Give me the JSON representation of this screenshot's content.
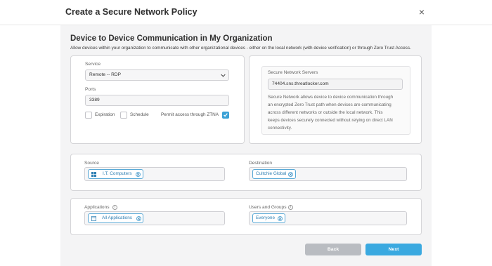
{
  "modal": {
    "title": "Create a Secure Network Policy",
    "close_glyph": "×"
  },
  "section": {
    "title": "Device to Device Communication in My Organization",
    "description": "Allow devices within your organization to communicate with other organizational devices - either on the local network (with device verification) or through Zero Trust Access."
  },
  "service": {
    "label": "Service",
    "value": "Remote -- RDP"
  },
  "ports": {
    "label": "Ports",
    "value": "3389"
  },
  "options": {
    "expiration": {
      "label": "Expiration",
      "checked": false
    },
    "schedule": {
      "label": "Schedule",
      "checked": false
    },
    "ztna": {
      "label": "Permit access through ZTNA",
      "checked": true
    }
  },
  "sns": {
    "label": "Secure Network Servers",
    "value": "74404.sns.threatlocker.com",
    "info": [
      "Secure Network allows device to device communication through",
      "an encrypted Zero Trust path when devices are communicating",
      "across different networks or outside the local network. This",
      "keeps devices securely connected without relying on direct LAN",
      "connectivity."
    ]
  },
  "source": {
    "label": "Source",
    "tag": "I.T. Computers",
    "tag_icon": "windows-icon"
  },
  "destination": {
    "label": "Destination",
    "tag": "Cultchie Global"
  },
  "applications": {
    "label": "Applications",
    "tag": "All Applications",
    "tag_icon": "application-window-icon",
    "info_icon": "i"
  },
  "users": {
    "label": "Users and Groups",
    "tag": "Everyone",
    "info_icon": "i"
  },
  "footer": {
    "back_label": "Back",
    "next_label": "Next"
  },
  "colors": {
    "accent": "#3aa9e0",
    "tag_border": "#5aa9d6",
    "back_button": "#b9bcc1",
    "panel_background": "#f4f4f5"
  }
}
